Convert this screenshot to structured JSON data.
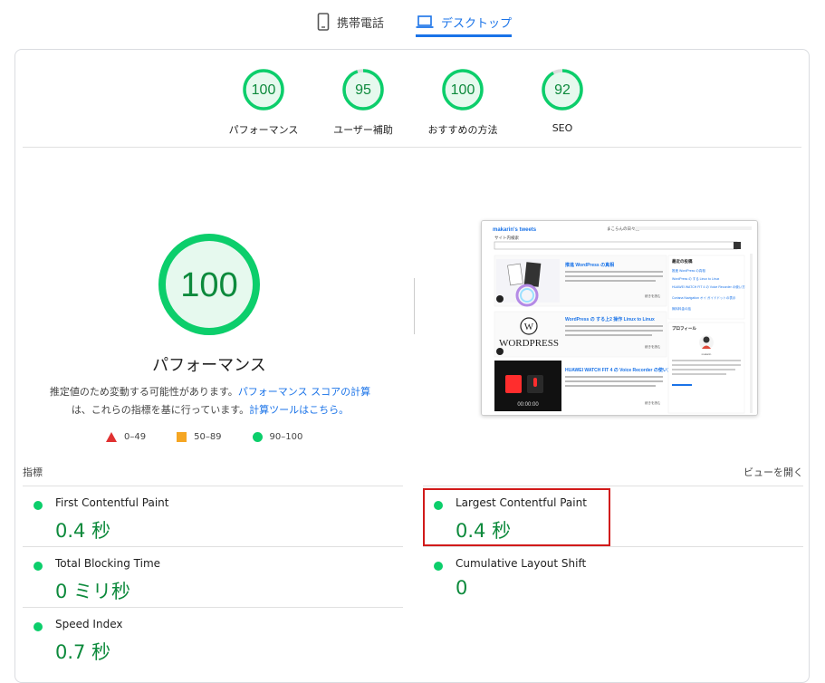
{
  "tabs": {
    "mobile": "携帯電話",
    "desktop": "デスクトップ"
  },
  "gauges": [
    {
      "score": "100",
      "label": "パフォーマンス",
      "value": 100
    },
    {
      "score": "95",
      "label": "ユーザー補助",
      "value": 95
    },
    {
      "score": "100",
      "label": "おすすめの方法",
      "value": 100
    },
    {
      "score": "92",
      "label": "SEO",
      "value": 92
    }
  ],
  "main": {
    "score": "100",
    "title": "パフォーマンス",
    "desc_1": "推定値のため変動する可能性があります。",
    "desc_link_1": "パフォーマンス スコアの計算",
    "desc_2": "は、これらの指標を基に行っています。",
    "desc_link_2": "計算ツールはこちら。"
  },
  "legend": {
    "red": "0–49",
    "orange": "50–89",
    "green": "90–100"
  },
  "metrics_header": {
    "title": "指標",
    "expand": "ビューを開く"
  },
  "metrics": {
    "fcp": {
      "name": "First Contentful Paint",
      "value": "0.4 秒"
    },
    "lcp": {
      "name": "Largest Contentful Paint",
      "value": "0.4 秒"
    },
    "tbt": {
      "name": "Total Blocking Time",
      "value": "0 ミリ秒"
    },
    "cls": {
      "name": "Cumulative Layout Shift",
      "value": "0"
    },
    "si": {
      "name": "Speed Index",
      "value": "0.7 秒"
    }
  },
  "screenshot": {
    "site_title": "makarin's tweets",
    "tagline": "まこらんの日々記",
    "search_label": "サイト内検索",
    "post1": "推進 WordPress の真相",
    "post2": "WordPress の する上2 操作 Linux to Linux",
    "post3": "HUAWEI WATCH FIT 4 の Voice Recorder の使い方",
    "side_title": "最近の投稿",
    "side_items": [
      "推進 WordPress の真相",
      "WordPress の する Linux to Linux",
      "HUAWEI WATCH FIT 4 の Voice Recorder の使い方",
      "Cortana Navigation オイ ガイドドットの表示",
      "無料料金の話"
    ],
    "profile": "プロフィール",
    "profile_name": "makarin",
    "wp_logo": "WORDPRESS",
    "timer": "00:00:00",
    "read_more": "続きを読む"
  },
  "colors": {
    "green": "#0cce6b",
    "green_text": "#0d8a3c",
    "orange": "#ffa400",
    "red": "#ff4e42",
    "blue": "#1a73e8"
  }
}
